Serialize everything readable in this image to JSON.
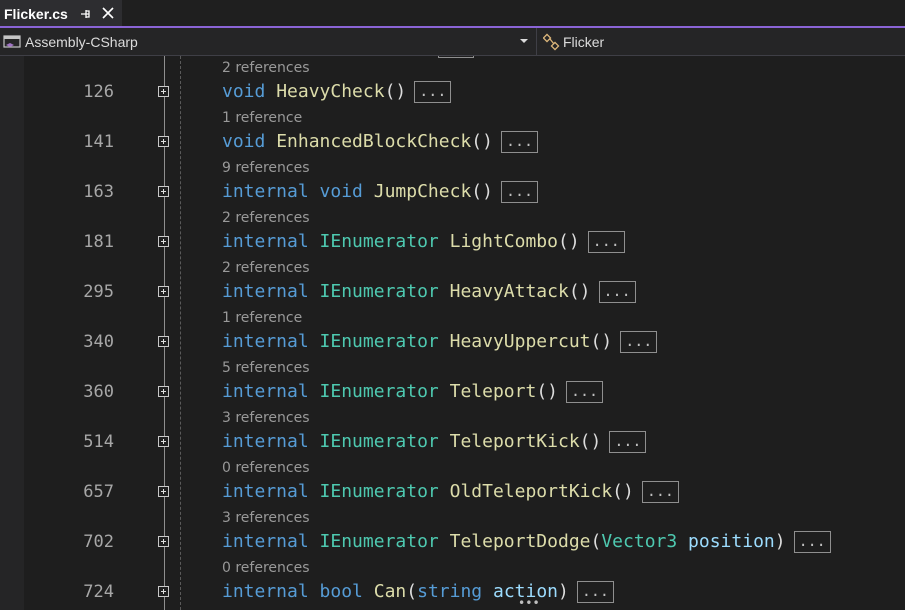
{
  "tab": {
    "title": "Flicker.cs"
  },
  "navbar": {
    "project": "Assembly-CSharp",
    "type": "Flicker"
  },
  "top_hint": "2 references",
  "collapsed_label": "...",
  "lines": [
    {
      "num": "126",
      "hint": "1 reference",
      "tokens": [
        {
          "t": "void",
          "c": "kw"
        },
        {
          "t": " ",
          "c": "pn"
        },
        {
          "t": "HeavyCheck",
          "c": "fn"
        },
        {
          "t": "()",
          "c": "pn"
        }
      ]
    },
    {
      "num": "141",
      "hint": "9 references",
      "tokens": [
        {
          "t": "void",
          "c": "kw"
        },
        {
          "t": " ",
          "c": "pn"
        },
        {
          "t": "EnhancedBlockCheck",
          "c": "fn"
        },
        {
          "t": "()",
          "c": "pn"
        }
      ]
    },
    {
      "num": "163",
      "hint": "2 references",
      "tokens": [
        {
          "t": "internal",
          "c": "kw"
        },
        {
          "t": " ",
          "c": "pn"
        },
        {
          "t": "void",
          "c": "kw"
        },
        {
          "t": " ",
          "c": "pn"
        },
        {
          "t": "JumpCheck",
          "c": "fn"
        },
        {
          "t": "()",
          "c": "pn"
        }
      ]
    },
    {
      "num": "181",
      "hint": "2 references",
      "tokens": [
        {
          "t": "internal",
          "c": "kw"
        },
        {
          "t": " ",
          "c": "pn"
        },
        {
          "t": "IEnumerator",
          "c": "ty"
        },
        {
          "t": " ",
          "c": "pn"
        },
        {
          "t": "LightCombo",
          "c": "fn"
        },
        {
          "t": "()",
          "c": "pn"
        }
      ]
    },
    {
      "num": "295",
      "hint": "1 reference",
      "tokens": [
        {
          "t": "internal",
          "c": "kw"
        },
        {
          "t": " ",
          "c": "pn"
        },
        {
          "t": "IEnumerator",
          "c": "ty"
        },
        {
          "t": " ",
          "c": "pn"
        },
        {
          "t": "HeavyAttack",
          "c": "fn"
        },
        {
          "t": "()",
          "c": "pn"
        }
      ]
    },
    {
      "num": "340",
      "hint": "5 references",
      "tokens": [
        {
          "t": "internal",
          "c": "kw"
        },
        {
          "t": " ",
          "c": "pn"
        },
        {
          "t": "IEnumerator",
          "c": "ty"
        },
        {
          "t": " ",
          "c": "pn"
        },
        {
          "t": "HeavyUppercut",
          "c": "fn"
        },
        {
          "t": "()",
          "c": "pn"
        }
      ]
    },
    {
      "num": "360",
      "hint": "3 references",
      "tokens": [
        {
          "t": "internal",
          "c": "kw"
        },
        {
          "t": " ",
          "c": "pn"
        },
        {
          "t": "IEnumerator",
          "c": "ty"
        },
        {
          "t": " ",
          "c": "pn"
        },
        {
          "t": "Teleport",
          "c": "fn"
        },
        {
          "t": "()",
          "c": "pn"
        }
      ]
    },
    {
      "num": "514",
      "hint": "0 references",
      "tokens": [
        {
          "t": "internal",
          "c": "kw"
        },
        {
          "t": " ",
          "c": "pn"
        },
        {
          "t": "IEnumerator",
          "c": "ty"
        },
        {
          "t": " ",
          "c": "pn"
        },
        {
          "t": "TeleportKick",
          "c": "fn"
        },
        {
          "t": "()",
          "c": "pn"
        }
      ]
    },
    {
      "num": "657",
      "hint": "3 references",
      "tokens": [
        {
          "t": "internal",
          "c": "kw"
        },
        {
          "t": " ",
          "c": "pn"
        },
        {
          "t": "IEnumerator",
          "c": "ty"
        },
        {
          "t": " ",
          "c": "pn"
        },
        {
          "t": "OldTeleportKick",
          "c": "fn"
        },
        {
          "t": "()",
          "c": "pn"
        }
      ]
    },
    {
      "num": "702",
      "hint": "0 references",
      "tokens": [
        {
          "t": "internal",
          "c": "kw"
        },
        {
          "t": " ",
          "c": "pn"
        },
        {
          "t": "IEnumerator",
          "c": "ty"
        },
        {
          "t": " ",
          "c": "pn"
        },
        {
          "t": "TeleportDodge",
          "c": "fn"
        },
        {
          "t": "(",
          "c": "pn"
        },
        {
          "t": "Vector3",
          "c": "ty"
        },
        {
          "t": " ",
          "c": "pn"
        },
        {
          "t": "position",
          "c": "pa"
        },
        {
          "t": ")",
          "c": "pn"
        }
      ]
    },
    {
      "num": "724",
      "hint": "",
      "tokens": [
        {
          "t": "internal",
          "c": "kw"
        },
        {
          "t": " ",
          "c": "pn"
        },
        {
          "t": "bool",
          "c": "kw"
        },
        {
          "t": " ",
          "c": "pn"
        },
        {
          "t": "Can",
          "c": "fn"
        },
        {
          "t": "(",
          "c": "pn"
        },
        {
          "t": "string",
          "c": "kw"
        },
        {
          "t": " ",
          "c": "pn"
        },
        {
          "t": "action",
          "c": "pa"
        },
        {
          "t": ")",
          "c": "pn"
        }
      ]
    }
  ]
}
